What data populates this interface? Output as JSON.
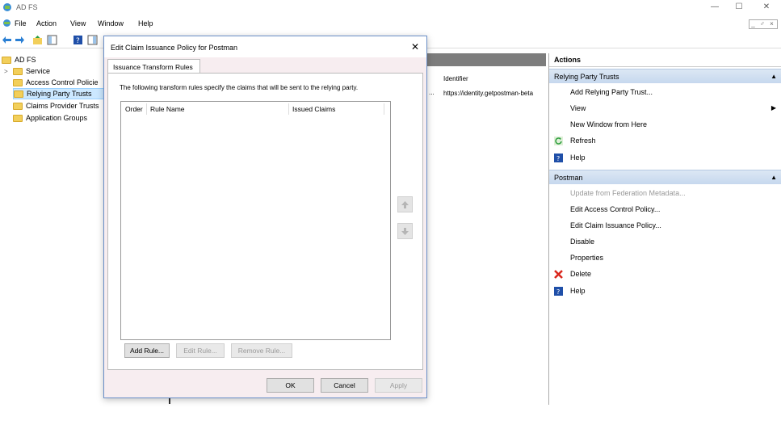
{
  "window": {
    "title": "AD FS",
    "minimize": "—",
    "maximize": "☐",
    "close": "✕",
    "mdi_controls": "_ ♂ ×"
  },
  "menu": {
    "items": [
      "File",
      "Action",
      "View",
      "Window",
      "Help"
    ]
  },
  "tree": {
    "items": [
      {
        "label": "AD FS"
      },
      {
        "label": "Service"
      },
      {
        "label": "Access Control Policie"
      },
      {
        "label": "Relying Party Trusts"
      },
      {
        "label": "Claims Provider Trusts"
      },
      {
        "label": "Application Groups"
      }
    ]
  },
  "center": {
    "column_identifier": "Identifier",
    "row_identifier": "https://identity.getpostman-beta",
    "row_marker": "..."
  },
  "actions": {
    "title": "Actions",
    "section1": {
      "label": "Relying Party Trusts",
      "items": [
        "Add Relying Party Trust...",
        "View",
        "New Window from Here",
        "Refresh",
        "Help"
      ]
    },
    "section2": {
      "label": "Postman",
      "items": [
        "Update from Federation Metadata...",
        "Edit Access Control Policy...",
        "Edit Claim Issuance Policy...",
        "Disable",
        "Properties",
        "Delete",
        "Help"
      ]
    }
  },
  "dialog": {
    "title": "Edit Claim Issuance Policy for Postman",
    "close": "✕",
    "tab": "Issuance Transform Rules",
    "description": "The following transform rules specify the claims that will be sent to the relying party.",
    "columns": [
      "Order",
      "Rule Name",
      "Issued Claims"
    ],
    "buttons": {
      "add_rule": "Add Rule...",
      "edit_rule": "Edit Rule...",
      "remove_rule": "Remove Rule...",
      "ok": "OK",
      "cancel": "Cancel",
      "apply": "Apply"
    }
  },
  "colors": {
    "section_bg": "#c6d8ee",
    "selection": "#cce8ff",
    "dialog_bg": "#f7edf0",
    "center_header": "#7d7d7d"
  }
}
